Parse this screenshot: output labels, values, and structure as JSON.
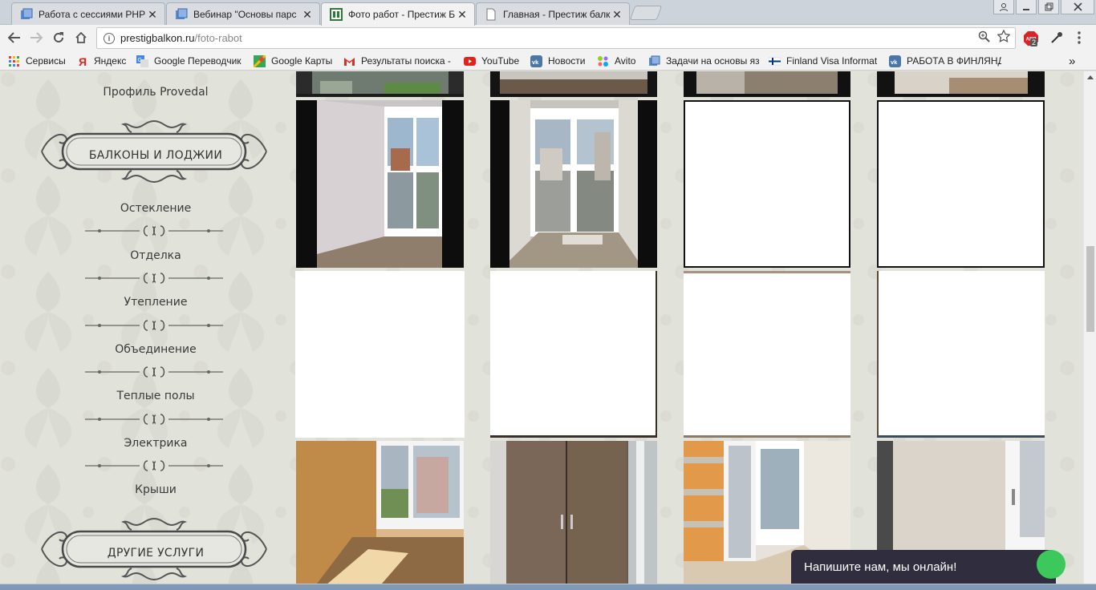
{
  "browser": {
    "tabs": [
      {
        "title": "Работа с сессиями PHP",
        "icon": "doc-blue-icon",
        "active": false
      },
      {
        "title": "Вебинар \"Основы парс",
        "icon": "doc-blue-icon",
        "active": false
      },
      {
        "title": "Фото работ - Престиж Б",
        "icon": "site-green-icon",
        "active": true
      },
      {
        "title": "Главная - Престиж балк",
        "icon": "page-icon",
        "active": false
      }
    ],
    "close_glyph": "✕",
    "address": {
      "host": "prestigbalkon.ru",
      "path": "/foto-rabot"
    },
    "bookmarks": [
      {
        "label": "Сервисы",
        "icon": "apps-grid-icon"
      },
      {
        "label": "Яндекс",
        "icon": "yandex-icon"
      },
      {
        "label": "Google Переводчик",
        "icon": "translate-icon"
      },
      {
        "label": "Google Карты",
        "icon": "maps-icon"
      },
      {
        "label": "Результаты поиска -",
        "icon": "gmail-icon"
      },
      {
        "label": "YouTube",
        "icon": "youtube-icon"
      },
      {
        "label": "Новости",
        "icon": "vk-icon"
      },
      {
        "label": "Avito",
        "icon": "avito-icon"
      },
      {
        "label": "Задачи на основы яз",
        "icon": "doc-blue-icon"
      },
      {
        "label": "Finland Visa Informat",
        "icon": "finland-flag-icon"
      },
      {
        "label": "РАБОТА В ФИНЛЯНД",
        "icon": "vk-icon"
      }
    ],
    "more_glyph": "»",
    "adblock_badge": "2"
  },
  "sidebar": {
    "top_item": "Профиль Provedal",
    "section1_title": "БАЛКОНЫ И ЛОДЖИИ",
    "items": [
      "Остекление",
      "Отделка",
      "Утепление",
      "Объединение",
      "Теплые полы",
      "Электрика",
      "Крыши"
    ],
    "section2_title": "ДРУГИЕ УСЛУГИ"
  },
  "chat": {
    "label": "Напишите нам, мы онлайн!"
  },
  "colors": {
    "chat_bg": "#2f2d3e",
    "chat_dot": "#3cc85a",
    "page_bg": "#e1e2da"
  }
}
